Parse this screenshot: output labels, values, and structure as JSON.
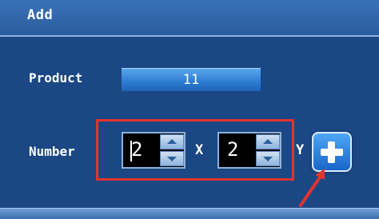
{
  "dialog": {
    "title": "Add"
  },
  "product": {
    "label": "Product",
    "value": "11"
  },
  "number": {
    "label": "Number",
    "rows_value": "2",
    "times": "X",
    "cols_value": "2",
    "trailing_char": "Y"
  },
  "actions": {
    "add_icon": "plus-icon"
  },
  "colors": {
    "background": "#1b4784",
    "title_bar": "#3a72b8",
    "highlight": "#e2342f",
    "accent_button": "#2b7bd2"
  }
}
